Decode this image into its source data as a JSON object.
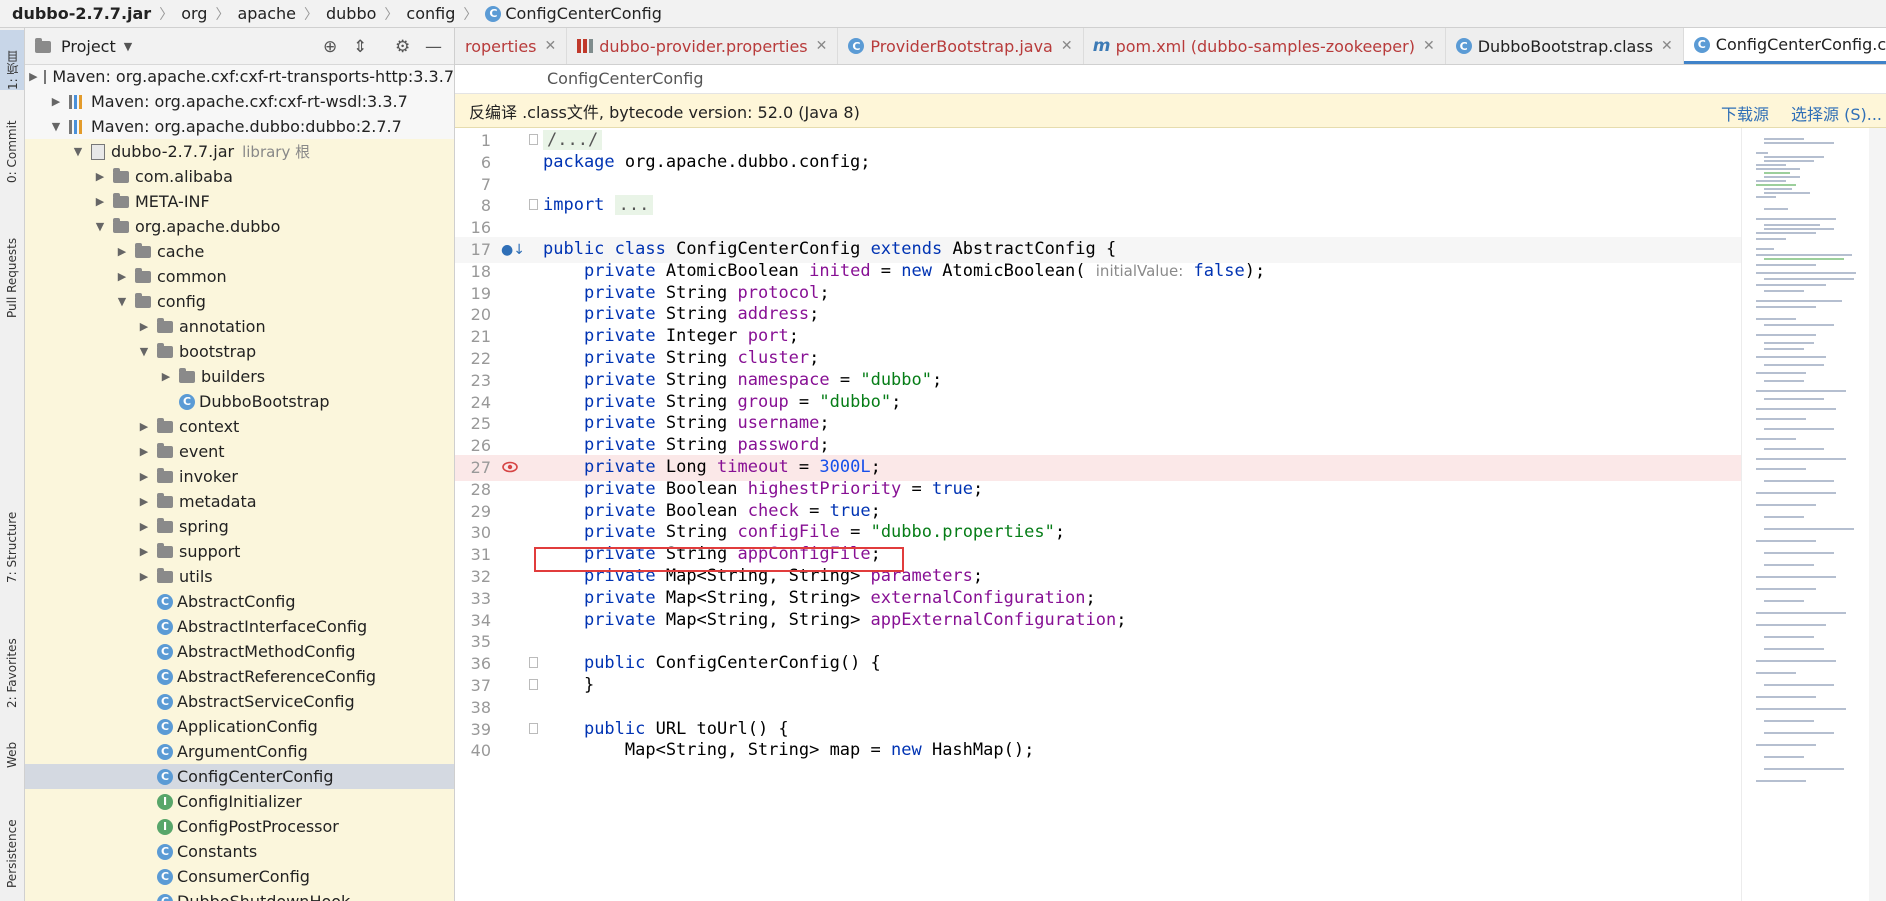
{
  "breadcrumb": [
    "dubbo-2.7.7.jar",
    "org",
    "apache",
    "dubbo",
    "config",
    "ConfigCenterConfig"
  ],
  "toolStrip": {
    "project": "1: 项目",
    "commit": "0: Commit",
    "pullRequests": "Pull Requests",
    "structure": "7: Structure",
    "favorites": "2: Favorites",
    "web": "Web",
    "persistence": "Persistence"
  },
  "projectPanel": {
    "title": "Project",
    "tree": [
      {
        "label": "Maven: org.apache.cxf:cxf-rt-transports-http:3.3.7",
        "dim": ""
      },
      {
        "label": "Maven: org.apache.cxf:cxf-rt-wsdl:3.3.7",
        "dim": ""
      },
      {
        "label": "Maven: org.apache.dubbo:dubbo:2.7.7",
        "dim": ""
      },
      {
        "label": "dubbo-2.7.7.jar",
        "dim": "library 根"
      },
      {
        "label": "com.alibaba",
        "dim": ""
      },
      {
        "label": "META-INF",
        "dim": ""
      },
      {
        "label": "org.apache.dubbo",
        "dim": ""
      },
      {
        "label": "cache",
        "dim": ""
      },
      {
        "label": "common",
        "dim": ""
      },
      {
        "label": "config",
        "dim": ""
      },
      {
        "label": "annotation",
        "dim": ""
      },
      {
        "label": "bootstrap",
        "dim": ""
      },
      {
        "label": "builders",
        "dim": ""
      },
      {
        "label": "DubboBootstrap",
        "dim": ""
      },
      {
        "label": "context",
        "dim": ""
      },
      {
        "label": "event",
        "dim": ""
      },
      {
        "label": "invoker",
        "dim": ""
      },
      {
        "label": "metadata",
        "dim": ""
      },
      {
        "label": "spring",
        "dim": ""
      },
      {
        "label": "support",
        "dim": ""
      },
      {
        "label": "utils",
        "dim": ""
      },
      {
        "label": "AbstractConfig",
        "dim": ""
      },
      {
        "label": "AbstractInterfaceConfig",
        "dim": ""
      },
      {
        "label": "AbstractMethodConfig",
        "dim": ""
      },
      {
        "label": "AbstractReferenceConfig",
        "dim": ""
      },
      {
        "label": "AbstractServiceConfig",
        "dim": ""
      },
      {
        "label": "ApplicationConfig",
        "dim": ""
      },
      {
        "label": "ArgumentConfig",
        "dim": ""
      },
      {
        "label": "ConfigCenterConfig",
        "dim": ""
      },
      {
        "label": "ConfigInitializer",
        "dim": ""
      },
      {
        "label": "ConfigPostProcessor",
        "dim": ""
      },
      {
        "label": "Constants",
        "dim": ""
      },
      {
        "label": "ConsumerConfig",
        "dim": ""
      },
      {
        "label": "DubboShutdownHook",
        "dim": ""
      }
    ]
  },
  "tabs": [
    {
      "label": "roperties"
    },
    {
      "label": "dubbo-provider.properties"
    },
    {
      "label": "ProviderBootstrap.java"
    },
    {
      "label": "pom.xml (dubbo-samples-zookeeper)"
    },
    {
      "label": "DubboBootstrap.class"
    },
    {
      "label": "ConfigCenterConfig.class"
    }
  ],
  "editor": {
    "breadcrumb": "ConfigCenterConfig",
    "banner": {
      "message": "反编译 .class文件, bytecode version: 52.0 (Java 8)",
      "download": "下载源",
      "choose": "选择源 (S)..."
    },
    "lines": [
      {
        "n": "1",
        "t": "/.../"
      },
      {
        "n": "6",
        "t": "package org.apache.dubbo.config;"
      },
      {
        "n": "7",
        "t": ""
      },
      {
        "n": "8",
        "t": "import ..."
      },
      {
        "n": "16",
        "t": ""
      },
      {
        "n": "17",
        "t": "public class ConfigCenterConfig extends AbstractConfig {"
      },
      {
        "n": "18",
        "t": "    private AtomicBoolean inited = new AtomicBoolean( initialValue: false);"
      },
      {
        "n": "19",
        "t": "    private String protocol;"
      },
      {
        "n": "20",
        "t": "    private String address;"
      },
      {
        "n": "21",
        "t": "    private Integer port;"
      },
      {
        "n": "22",
        "t": "    private String cluster;"
      },
      {
        "n": "23",
        "t": "    private String namespace = \"dubbo\";"
      },
      {
        "n": "24",
        "t": "    private String group = \"dubbo\";"
      },
      {
        "n": "25",
        "t": "    private String username;"
      },
      {
        "n": "26",
        "t": "    private String password;"
      },
      {
        "n": "27",
        "t": "    private Long timeout = 3000L;"
      },
      {
        "n": "28",
        "t": "    private Boolean highestPriority = true;"
      },
      {
        "n": "29",
        "t": "    private Boolean check = true;"
      },
      {
        "n": "30",
        "t": "    private String configFile = \"dubbo.properties\";"
      },
      {
        "n": "31",
        "t": "    private String appConfigFile;"
      },
      {
        "n": "32",
        "t": "    private Map<String, String> parameters;"
      },
      {
        "n": "33",
        "t": "    private Map<String, String> externalConfiguration;"
      },
      {
        "n": "34",
        "t": "    private Map<String, String> appExternalConfiguration;"
      },
      {
        "n": "35",
        "t": ""
      },
      {
        "n": "36",
        "t": "    public ConfigCenterConfig() {"
      },
      {
        "n": "37",
        "t": "    }"
      },
      {
        "n": "38",
        "t": ""
      },
      {
        "n": "39",
        "t": "    public URL toUrl() {"
      },
      {
        "n": "40",
        "t": "        Map<String, String> map = new HashMap();"
      }
    ]
  },
  "colors": {
    "keyword": "#0033b3",
    "string": "#067d17",
    "field": "#871094",
    "number": "#1750eb",
    "highlight": "#e13c3c"
  }
}
